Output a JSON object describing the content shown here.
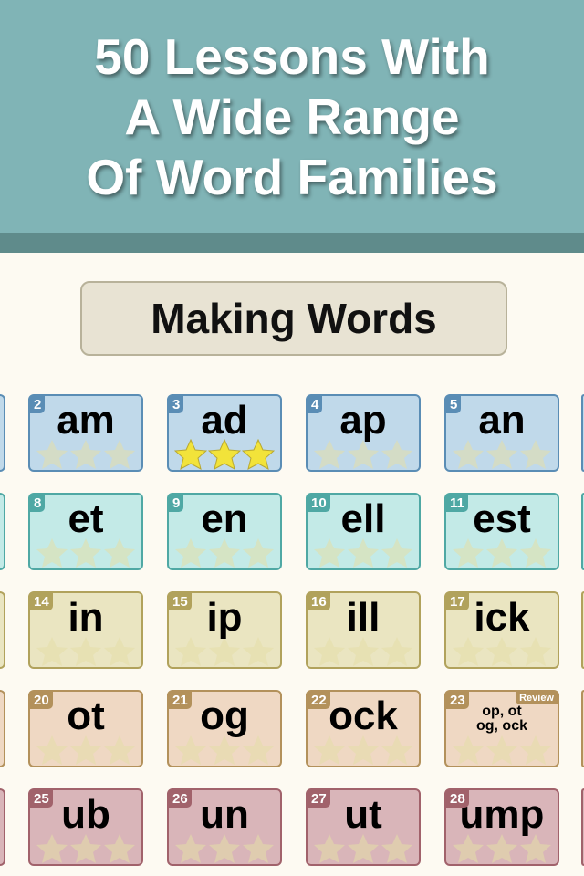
{
  "header": {
    "title_lines": [
      "50 Lessons With",
      "A Wide Range",
      "Of Word Families"
    ]
  },
  "section": {
    "title": "Making Words"
  },
  "row_colors": [
    {
      "bg": "#c0d9ea",
      "border": "#5a8db5"
    },
    {
      "bg": "#c3eae7",
      "border": "#4fa8a4"
    },
    {
      "bg": "#eae5c1",
      "border": "#b1a25c"
    },
    {
      "bg": "#efd8c3",
      "border": "#b3915b"
    },
    {
      "bg": "#d9b5b9",
      "border": "#a1626b"
    }
  ],
  "star_colors": {
    "earned": "#f2e33a",
    "empty": "#e4dfa8"
  },
  "lessons": [
    [
      {
        "num": "2",
        "word": "am",
        "stars": 0
      },
      {
        "num": "3",
        "word": "ad",
        "stars": 3
      },
      {
        "num": "4",
        "word": "ap",
        "stars": 0
      },
      {
        "num": "5",
        "word": "an",
        "stars": 0
      }
    ],
    [
      {
        "num": "8",
        "word": "et",
        "stars": 0
      },
      {
        "num": "9",
        "word": "en",
        "stars": 0
      },
      {
        "num": "10",
        "word": "ell",
        "stars": 0
      },
      {
        "num": "11",
        "word": "est",
        "stars": 0
      }
    ],
    [
      {
        "num": "14",
        "word": "in",
        "stars": 0
      },
      {
        "num": "15",
        "word": "ip",
        "stars": 0
      },
      {
        "num": "16",
        "word": "ill",
        "stars": 0
      },
      {
        "num": "17",
        "word": "ick",
        "stars": 0
      }
    ],
    [
      {
        "num": "20",
        "word": "ot",
        "stars": 0
      },
      {
        "num": "21",
        "word": "og",
        "stars": 0
      },
      {
        "num": "22",
        "word": "ock",
        "stars": 0
      },
      {
        "num": "23",
        "word": "op, ot\nog, ock",
        "badge": "Review",
        "stars": 0
      }
    ],
    [
      {
        "num": "25",
        "word": "ub",
        "stars": 0
      },
      {
        "num": "26",
        "word": "un",
        "stars": 0
      },
      {
        "num": "27",
        "word": "ut",
        "stars": 0
      },
      {
        "num": "28",
        "word": "ump",
        "stars": 0
      }
    ]
  ]
}
